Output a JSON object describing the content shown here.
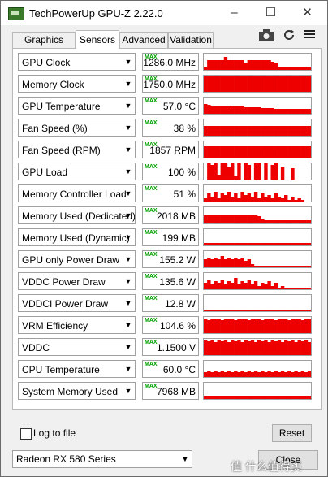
{
  "window": {
    "title": "TechPowerUp GPU-Z 2.22.0"
  },
  "controls": {
    "minimize": "–",
    "maximize": "☐",
    "close": "✕"
  },
  "tabs": [
    {
      "label": "Graphics Card",
      "active": false
    },
    {
      "label": "Sensors",
      "active": true
    },
    {
      "label": "Advanced",
      "active": false
    },
    {
      "label": "Validation",
      "active": false
    }
  ],
  "toolbar": {
    "camera_icon": "camera-icon",
    "refresh_icon": "refresh-icon",
    "menu_icon": "menu-icon"
  },
  "max_tag": "MAX",
  "graph_color": "#ee0000",
  "sensors": [
    {
      "name": "GPU Clock",
      "value": "1286.0 MHz",
      "graph": [
        0.2,
        0.6,
        0.6,
        0.6,
        0.6,
        0.6,
        0.8,
        0.6,
        0.6,
        0.6,
        0.6,
        0.6,
        0.4,
        0.6,
        0.6,
        0.6,
        0.6,
        0.6,
        0.6,
        0.6,
        0.5,
        0.4,
        0.2,
        0.2,
        0.2,
        0.2,
        0.2,
        0.2,
        0.2,
        0.2,
        0.2,
        0.2
      ]
    },
    {
      "name": "Memory Clock",
      "value": "1750.0 MHz",
      "graph": [
        1,
        1,
        1,
        1,
        1,
        1,
        1,
        1,
        1,
        1,
        1,
        1,
        1,
        1,
        1,
        1,
        1,
        1,
        1,
        1,
        1,
        1,
        1,
        1,
        1,
        1,
        1,
        1,
        1,
        1,
        1,
        1
      ]
    },
    {
      "name": "GPU Temperature",
      "value": "57.0 °C",
      "graph": [
        0.6,
        0.55,
        0.5,
        0.5,
        0.5,
        0.5,
        0.5,
        0.5,
        0.45,
        0.45,
        0.45,
        0.45,
        0.4,
        0.4,
        0.4,
        0.4,
        0.4,
        0.35,
        0.35,
        0.35,
        0.35,
        0.3,
        0.3,
        0.3,
        0.3,
        0.3,
        0.3,
        0.3,
        0.3,
        0.3,
        0.3,
        0.3
      ]
    },
    {
      "name": "Fan Speed (%)",
      "value": "38 %",
      "graph": [
        0.6,
        0.6,
        0.6,
        0.6,
        0.6,
        0.6,
        0.6,
        0.6,
        0.6,
        0.6,
        0.6,
        0.6,
        0.6,
        0.6,
        0.6,
        0.6,
        0.6,
        0.6,
        0.6,
        0.6,
        0.6,
        0.6,
        0.6,
        0.6,
        0.6,
        0.6,
        0.6,
        0.6,
        0.6,
        0.6,
        0.6,
        0.6
      ]
    },
    {
      "name": "Fan Speed (RPM)",
      "value": "1857 RPM",
      "graph": [
        0.7,
        0.7,
        0.7,
        0.7,
        0.7,
        0.7,
        0.7,
        0.7,
        0.7,
        0.7,
        0.7,
        0.7,
        0.7,
        0.7,
        0.7,
        0.7,
        0.7,
        0.7,
        0.7,
        0.7,
        0.7,
        0.7,
        0.7,
        0.7,
        0.7,
        0.7,
        0.7,
        0.7,
        0.7,
        0.7,
        0.7,
        0.7
      ]
    },
    {
      "name": "GPU Load",
      "value": "100 %",
      "graph": [
        0,
        1,
        0.9,
        1,
        0.3,
        1,
        1,
        0.8,
        1,
        0.2,
        1,
        0,
        1,
        0.9,
        0,
        1,
        1,
        0,
        1,
        0,
        0.9,
        1,
        0,
        0.8,
        0,
        0,
        0.7,
        0,
        0,
        0,
        0,
        0
      ]
    },
    {
      "name": "Memory Controller Load",
      "value": "51 %",
      "graph": [
        0.2,
        0.5,
        0.3,
        0.6,
        0.2,
        0.5,
        0.4,
        0.6,
        0.3,
        0.5,
        0.2,
        0.6,
        0.4,
        0.5,
        0.3,
        0.6,
        0.2,
        0.5,
        0.3,
        0.4,
        0.2,
        0.5,
        0.3,
        0.2,
        0.4,
        0.1,
        0.3,
        0.1,
        0.2,
        0.1,
        0,
        0
      ]
    },
    {
      "name": "Memory Used (Dedicated)",
      "value": "2018 MB",
      "graph": [
        0.5,
        0.5,
        0.5,
        0.5,
        0.5,
        0.5,
        0.5,
        0.5,
        0.5,
        0.5,
        0.5,
        0.5,
        0.5,
        0.5,
        0.5,
        0.5,
        0.45,
        0.3,
        0.2,
        0.2,
        0.2,
        0.2,
        0.2,
        0.2,
        0.2,
        0.2,
        0.2,
        0.2,
        0.2,
        0.2,
        0.2,
        0.2
      ]
    },
    {
      "name": "Memory Used (Dynamic)",
      "value": "199 MB",
      "graph": [
        0.15,
        0.15,
        0.15,
        0.15,
        0.15,
        0.15,
        0.15,
        0.15,
        0.15,
        0.15,
        0.15,
        0.15,
        0.15,
        0.15,
        0.15,
        0.15,
        0.15,
        0.15,
        0.15,
        0.15,
        0.15,
        0.15,
        0.15,
        0.15,
        0.15,
        0.15,
        0.15,
        0.15,
        0.15,
        0.15,
        0.15,
        0.15
      ]
    },
    {
      "name": "GPU only Power Draw",
      "value": "155.2 W",
      "graph": [
        0.5,
        0.6,
        0.5,
        0.6,
        0.5,
        0.7,
        0.5,
        0.6,
        0.5,
        0.6,
        0.5,
        0.6,
        0.4,
        0.5,
        0.2,
        0.1,
        0.1,
        0.1,
        0.1,
        0.1,
        0.1,
        0.1,
        0.1,
        0.1,
        0.1,
        0.1,
        0.1,
        0.1,
        0.1,
        0.1,
        0.1,
        0.1
      ]
    },
    {
      "name": "VDDC Power Draw",
      "value": "135.6 W",
      "graph": [
        0.4,
        0.6,
        0.3,
        0.5,
        0.4,
        0.6,
        0.3,
        0.5,
        0.4,
        0.7,
        0.3,
        0.5,
        0.4,
        0.6,
        0.3,
        0.5,
        0.2,
        0.4,
        0.3,
        0.5,
        0.2,
        0.4,
        0.1,
        0.2,
        0.1,
        0.1,
        0.1,
        0.1,
        0.1,
        0.1,
        0.1,
        0.1
      ]
    },
    {
      "name": "VDDCI Power Draw",
      "value": "12.8 W",
      "graph": [
        0.1,
        0.1,
        0.1,
        0.1,
        0.1,
        0.1,
        0.1,
        0.1,
        0.1,
        0.1,
        0.1,
        0.1,
        0.1,
        0.1,
        0.1,
        0.1,
        0.1,
        0.1,
        0.1,
        0.1,
        0.1,
        0.1,
        0.1,
        0.1,
        0.1,
        0.1,
        0.1,
        0.1,
        0.1,
        0.1,
        0.1,
        0.1
      ]
    },
    {
      "name": "VRM Efficiency",
      "value": "104.6 %",
      "graph": [
        0.9,
        0.8,
        0.9,
        0.85,
        0.9,
        0.8,
        0.9,
        0.85,
        0.9,
        0.8,
        0.9,
        0.85,
        0.9,
        0.8,
        0.9,
        0.85,
        0.9,
        0.8,
        0.9,
        0.85,
        0.9,
        0.8,
        0.9,
        0.85,
        0.9,
        0.8,
        0.9,
        0.85,
        0.9,
        0.8,
        0.9,
        0.85
      ]
    },
    {
      "name": "VDDC",
      "value": "1.1500 V",
      "graph": [
        0.9,
        0.85,
        0.9,
        0.8,
        0.9,
        0.85,
        0.9,
        0.8,
        0.9,
        0.85,
        0.9,
        0.8,
        0.9,
        0.85,
        0.9,
        0.8,
        0.9,
        0.85,
        0.9,
        0.8,
        0.9,
        0.85,
        0.9,
        0.8,
        0.9,
        0.85,
        0.9,
        0.8,
        0.9,
        0.85,
        0.9,
        0.8
      ]
    },
    {
      "name": "CPU Temperature",
      "value": "60.0 °C",
      "graph": [
        0.3,
        0.35,
        0.3,
        0.35,
        0.3,
        0.35,
        0.3,
        0.35,
        0.3,
        0.35,
        0.3,
        0.35,
        0.3,
        0.35,
        0.3,
        0.35,
        0.3,
        0.35,
        0.3,
        0.35,
        0.3,
        0.35,
        0.3,
        0.35,
        0.3,
        0.35,
        0.3,
        0.35,
        0.3,
        0.35,
        0.3,
        0.35
      ]
    },
    {
      "name": "System Memory Used",
      "value": "7968 MB",
      "graph": [
        0.2,
        0.2,
        0.2,
        0.2,
        0.2,
        0.2,
        0.2,
        0.2,
        0.2,
        0.2,
        0.2,
        0.2,
        0.2,
        0.2,
        0.2,
        0.2,
        0.2,
        0.2,
        0.2,
        0.2,
        0.2,
        0.2,
        0.2,
        0.2,
        0.2,
        0.2,
        0.2,
        0.2,
        0.2,
        0.2,
        0.2,
        0.2
      ]
    }
  ],
  "log_to_file": {
    "label": "Log to file",
    "checked": false
  },
  "reset_label": "Reset",
  "gpu_select": {
    "value": "Radeon RX 580 Series"
  },
  "close_label": "Close",
  "watermark": "值 什么值得买"
}
